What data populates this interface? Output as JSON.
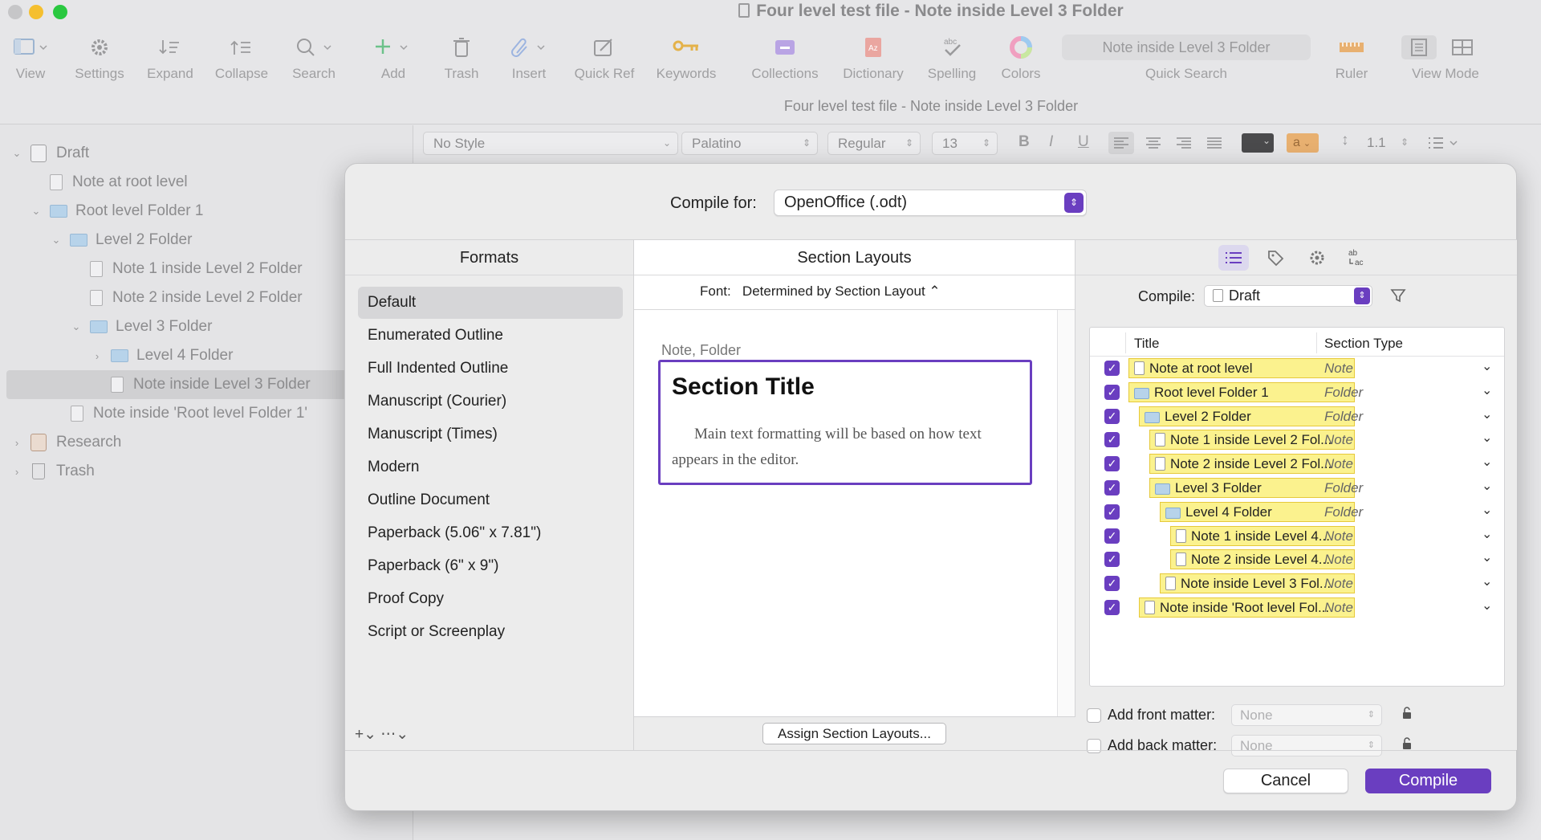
{
  "window": {
    "title": "Four level test file - Note inside Level 3 Folder",
    "subtitle": "Four level test file - Note inside Level 3 Folder"
  },
  "toolbar": {
    "items": [
      {
        "label": "View",
        "icon": "sidebar-icon"
      },
      {
        "label": "Settings",
        "icon": "gear-icon"
      },
      {
        "label": "Expand",
        "icon": "expand-icon"
      },
      {
        "label": "Collapse",
        "icon": "collapse-icon"
      },
      {
        "label": "Search",
        "icon": "search-icon"
      },
      {
        "label": "Add",
        "icon": "plus-icon"
      },
      {
        "label": "Trash",
        "icon": "trash-icon"
      },
      {
        "label": "Insert",
        "icon": "paperclip-icon"
      },
      {
        "label": "Quick Ref",
        "icon": "quick-ref-icon"
      },
      {
        "label": "Keywords",
        "icon": "key-icon"
      },
      {
        "label": "Collections",
        "icon": "collections-icon"
      },
      {
        "label": "Dictionary",
        "icon": "dictionary-icon"
      },
      {
        "label": "Spelling",
        "icon": "spelling-icon"
      },
      {
        "label": "Colors",
        "icon": "color-wheel-icon"
      },
      {
        "label": "Ruler",
        "icon": "ruler-icon"
      },
      {
        "label": "View Mode",
        "icon": "view-mode-icon"
      }
    ],
    "quick_search": {
      "value": "Note inside Level 3 Folder",
      "label": "Quick Search"
    }
  },
  "binder": {
    "items": [
      {
        "label": "Draft"
      },
      {
        "label": "Note at root level"
      },
      {
        "label": "Root level Folder 1"
      },
      {
        "label": "Level 2 Folder"
      },
      {
        "label": "Note 1 inside Level 2 Folder"
      },
      {
        "label": "Note 2 inside Level 2 Folder"
      },
      {
        "label": "Level 3 Folder"
      },
      {
        "label": "Level 4 Folder"
      },
      {
        "label": "Note inside Level 3 Folder"
      },
      {
        "label": "Note inside 'Root level Folder 1'"
      },
      {
        "label": "Research"
      },
      {
        "label": "Trash"
      }
    ]
  },
  "formatbar": {
    "style": "No Style",
    "font": "Palatino",
    "weight": "Regular",
    "size": "13",
    "bold": "B",
    "italic": "I",
    "underline": "U",
    "highlight": "a",
    "line_spacing": "1.1"
  },
  "dialog": {
    "compile_for_label": "Compile for:",
    "compile_for_value": "OpenOffice (.odt)",
    "formats": {
      "header": "Formats",
      "items": [
        "Default",
        "Enumerated Outline",
        "Full Indented Outline",
        "Manuscript (Courier)",
        "Manuscript (Times)",
        "Modern",
        "Outline Document",
        "Paperback (5.06\" x 7.81\")",
        "Paperback (6\" x 9\")",
        "Proof Copy",
        "Script or Screenplay"
      ],
      "footer": "+⌄   ⋯⌄"
    },
    "layouts": {
      "header": "Section Layouts",
      "font_label": "Font:",
      "font_value": "Determined by Section Layout ⌃",
      "preview_caption": "Note, Folder",
      "preview_title": "Section Title",
      "preview_text": "Main text formatting will be based on how text appears in the editor.",
      "assign_button": "Assign Section Layouts..."
    },
    "contents": {
      "compile_label": "Compile:",
      "compile_value": "Draft",
      "col_title": "Title",
      "col_type": "Section Type",
      "rows": [
        {
          "title": "Note at root level",
          "type": "Note",
          "kind": "note",
          "indent": 0
        },
        {
          "title": "Root level Folder 1",
          "type": "Folder",
          "kind": "folder",
          "indent": 0
        },
        {
          "title": "Level 2 Folder",
          "type": "Folder",
          "kind": "folder",
          "indent": 1
        },
        {
          "title": "Note 1 inside Level 2 Fol...",
          "type": "Note",
          "kind": "note",
          "indent": 2
        },
        {
          "title": "Note 2 inside Level 2 Fol...",
          "type": "Note",
          "kind": "note",
          "indent": 2
        },
        {
          "title": "Level 3 Folder",
          "type": "Folder",
          "kind": "folder",
          "indent": 2
        },
        {
          "title": "Level 4 Folder",
          "type": "Folder",
          "kind": "folder",
          "indent": 3
        },
        {
          "title": "Note 1 inside Level 4...",
          "type": "Note",
          "kind": "note",
          "indent": 4
        },
        {
          "title": "Note 2 inside Level 4...",
          "type": "Note",
          "kind": "note",
          "indent": 4
        },
        {
          "title": "Note inside Level 3 Fol...",
          "type": "Note",
          "kind": "note",
          "indent": 3
        },
        {
          "title": "Note inside 'Root level Fol...",
          "type": "Note",
          "kind": "note",
          "indent": 1
        }
      ],
      "front_matter_label": "Add front matter:",
      "front_matter_value": "None",
      "back_matter_label": "Add back matter:",
      "back_matter_value": "None"
    },
    "cancel": "Cancel",
    "compile": "Compile"
  },
  "colors": {
    "accent": "#6a3ec0",
    "highlight": "#fbf28e"
  }
}
